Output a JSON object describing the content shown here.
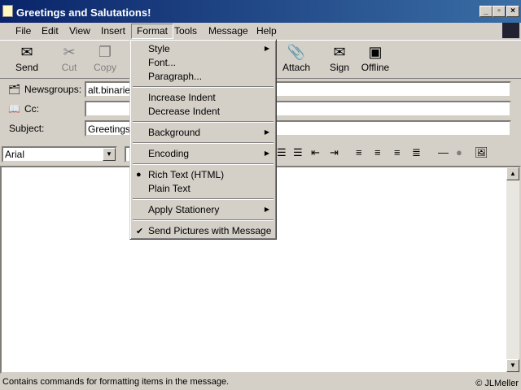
{
  "window": {
    "title": "Greetings and Salutations!",
    "min": "_",
    "max": "▫",
    "close": "×"
  },
  "menubar": [
    "File",
    "Edit",
    "View",
    "Insert",
    "Format",
    "Tools",
    "Message",
    "Help"
  ],
  "toolbar": {
    "send": "Send",
    "cut": "Cut",
    "copy": "Copy",
    "attach": "Attach",
    "sign": "Sign",
    "offline": "Offline"
  },
  "headers": {
    "newsgroups_label": "Newsgroups:",
    "newsgroups_value": "alt.binaries",
    "cc_label": "Cc:",
    "cc_value": "",
    "subject_label": "Subject:",
    "subject_value": "Greetings a"
  },
  "format_bar": {
    "font": "Arial"
  },
  "format_menu": {
    "items": [
      "Style",
      "Font...",
      "Paragraph...",
      "Increase Indent",
      "Decrease Indent",
      "Background",
      "Encoding",
      "Rich Text (HTML)",
      "Plain Text",
      "Apply Stationery",
      "Send Pictures with Message"
    ],
    "checked_rich": "●",
    "checked_send": "✔"
  },
  "status": {
    "text": "Contains commands for formatting items in the message.",
    "copyright": "© JLMeller"
  }
}
